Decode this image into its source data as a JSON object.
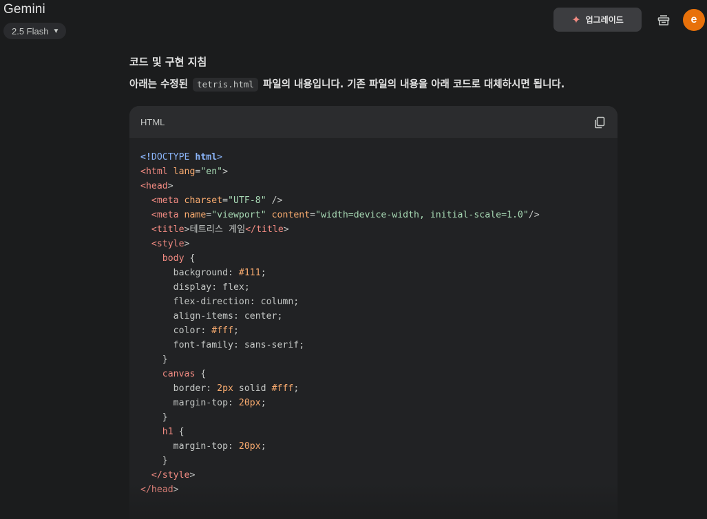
{
  "header": {
    "app_title": "Gemini",
    "model": "2.5 Flash",
    "upgrade_label": "업그레이드",
    "avatar_letter": "e",
    "colors": {
      "avatar_bg": "#e8710a",
      "sparkle": "#f28b82"
    }
  },
  "content": {
    "heading": "코드 및 구현 지침",
    "para_before": "아래는 수정된",
    "inline_code": "tetris.html",
    "para_after": "파일의 내용입니다. 기존 파일의 내용을 아래 코드로 대체하시면 됩니다.",
    "code_lang": "HTML",
    "code_lines": [
      [
        [
          "<!",
          "t-kw"
        ],
        [
          "DOCTYPE",
          "t-kw-plain"
        ],
        [
          " html",
          "t-kw"
        ],
        [
          ">",
          "t-kw-plain"
        ]
      ],
      [
        [
          "<html",
          "t-tag"
        ],
        [
          " lang",
          "t-attr"
        ],
        [
          "=",
          "t-punc"
        ],
        [
          "\"en\"",
          "t-str"
        ],
        [
          ">",
          "t-punc"
        ]
      ],
      [
        [
          "<head",
          "t-tag"
        ],
        [
          ">",
          "t-punc"
        ]
      ],
      [
        [
          "  <meta",
          "t-tag"
        ],
        [
          " charset",
          "t-attr"
        ],
        [
          "=",
          "t-punc"
        ],
        [
          "\"UTF-8\"",
          "t-str"
        ],
        [
          " />",
          "t-punc"
        ]
      ],
      [
        [
          "  <meta",
          "t-tag"
        ],
        [
          " name",
          "t-attr"
        ],
        [
          "=",
          "t-punc"
        ],
        [
          "\"viewport\"",
          "t-str"
        ],
        [
          " content",
          "t-attr"
        ],
        [
          "=",
          "t-punc"
        ],
        [
          "\"width=device-width, initial-scale=1.0\"",
          "t-str"
        ],
        [
          "/>",
          "t-punc"
        ]
      ],
      [
        [
          "  <title",
          "t-tag"
        ],
        [
          ">테트리스 게임",
          "t-punc"
        ],
        [
          "</title",
          "t-tag"
        ],
        [
          ">",
          "t-punc"
        ]
      ],
      [
        [
          "  <style",
          "t-tag"
        ],
        [
          ">",
          "t-punc"
        ]
      ],
      [
        [
          "    body",
          "t-sel"
        ],
        [
          " {",
          "t-punc"
        ]
      ],
      [
        [
          "      background: ",
          "t-punc"
        ],
        [
          "#111",
          "t-num"
        ],
        [
          ";",
          "t-punc"
        ]
      ],
      [
        [
          "      display: flex;",
          "t-punc"
        ]
      ],
      [
        [
          "      flex-direction: column;",
          "t-punc"
        ]
      ],
      [
        [
          "      align-items: center;",
          "t-punc"
        ]
      ],
      [
        [
          "      color: ",
          "t-punc"
        ],
        [
          "#fff",
          "t-num"
        ],
        [
          ";",
          "t-punc"
        ]
      ],
      [
        [
          "      font-family: sans-serif;",
          "t-punc"
        ]
      ],
      [
        [
          "    }",
          "t-punc"
        ]
      ],
      [
        [
          "    canvas",
          "t-sel"
        ],
        [
          " {",
          "t-punc"
        ]
      ],
      [
        [
          "      border: ",
          "t-punc"
        ],
        [
          "2px",
          "t-num"
        ],
        [
          " solid ",
          "t-punc"
        ],
        [
          "#fff",
          "t-num"
        ],
        [
          ";",
          "t-punc"
        ]
      ],
      [
        [
          "      margin-top: ",
          "t-punc"
        ],
        [
          "20px",
          "t-num"
        ],
        [
          ";",
          "t-punc"
        ]
      ],
      [
        [
          "    }",
          "t-punc"
        ]
      ],
      [
        [
          "    h1",
          "t-sel"
        ],
        [
          " {",
          "t-punc"
        ]
      ],
      [
        [
          "      margin-top: ",
          "t-punc"
        ],
        [
          "20px",
          "t-num"
        ],
        [
          ";",
          "t-punc"
        ]
      ],
      [
        [
          "    }",
          "t-punc"
        ]
      ],
      [
        [
          "  </style",
          "t-tag"
        ],
        [
          ">",
          "t-punc"
        ]
      ],
      [
        [
          "</head",
          "t-tag"
        ],
        [
          ">",
          "t-punc"
        ]
      ]
    ]
  }
}
